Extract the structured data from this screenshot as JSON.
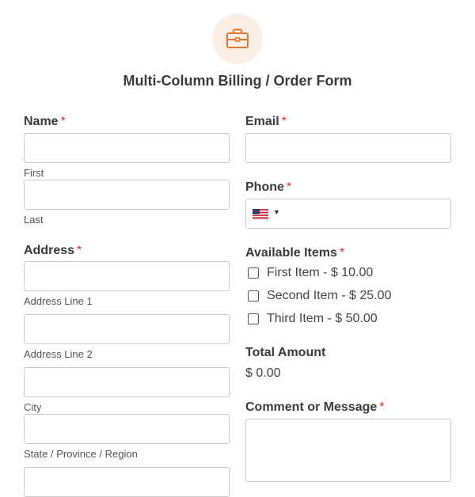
{
  "form": {
    "title": "Multi-Column Billing / Order Form",
    "icon": "briefcase-icon",
    "accent_color": "#e27730",
    "required_marker": "*"
  },
  "fields": {
    "name": {
      "label": "Name",
      "first_sublabel": "First",
      "last_sublabel": "Last",
      "first_value": "",
      "last_value": ""
    },
    "email": {
      "label": "Email",
      "value": ""
    },
    "phone": {
      "label": "Phone",
      "country_flag_icon": "us-flag-icon",
      "value": ""
    },
    "address": {
      "label": "Address",
      "line1_sublabel": "Address Line 1",
      "line2_sublabel": "Address Line 2",
      "city_sublabel": "City",
      "state_sublabel": "State / Province / Region"
    },
    "items": {
      "label": "Available Items",
      "options": [
        {
          "label": "First Item - $ 10.00",
          "checked": false
        },
        {
          "label": "Second Item - $ 25.00",
          "checked": false
        },
        {
          "label": "Third Item - $ 50.00",
          "checked": false
        }
      ]
    },
    "total": {
      "label": "Total Amount",
      "value": "$ 0.00"
    },
    "comment": {
      "label": "Comment or Message",
      "value": ""
    }
  }
}
